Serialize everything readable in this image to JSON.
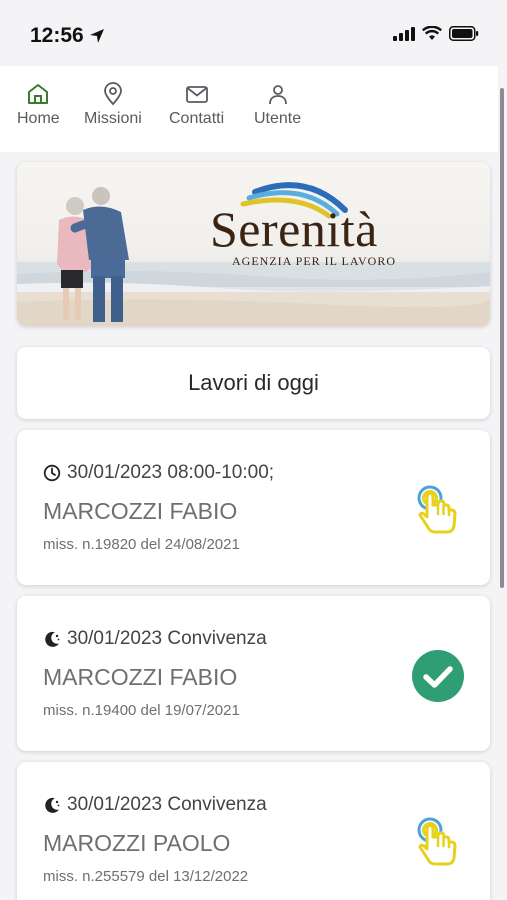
{
  "status_bar": {
    "time": "12:56"
  },
  "nav": {
    "items": [
      {
        "label": "Home",
        "icon": "home-icon",
        "active": true
      },
      {
        "label": "Missioni",
        "icon": "location-pin-icon"
      },
      {
        "label": "Contatti",
        "icon": "mail-icon"
      },
      {
        "label": "Utente",
        "icon": "user-icon"
      }
    ]
  },
  "banner": {
    "brand": "Serenità",
    "tagline": "AGENZIA PER IL LAVORO"
  },
  "section_title": "Lavori di oggi",
  "jobs": [
    {
      "icon": "clock-icon",
      "line1": "30/01/2023 08:00-10:00;",
      "name": "MARCOZZI FABIO",
      "sub": "miss. n.19820 del 24/08/2021",
      "action": "tap-hand-icon"
    },
    {
      "icon": "moon-icon",
      "line1": "30/01/2023 Convivenza",
      "name": "MARCOZZI FABIO",
      "sub": "miss. n.19400 del 19/07/2021",
      "action": "check-icon"
    },
    {
      "icon": "moon-icon",
      "line1": "30/01/2023 Convivenza",
      "name": "MAROZZI PAOLO",
      "sub": "miss. n.255579 del 13/12/2022",
      "action": "tap-hand-icon"
    }
  ],
  "colors": {
    "accent_green": "#2f9e74",
    "home_icon": "#3d7a2b",
    "tap_yellow": "#e6d21c",
    "tap_blue": "#4aa3d8"
  }
}
